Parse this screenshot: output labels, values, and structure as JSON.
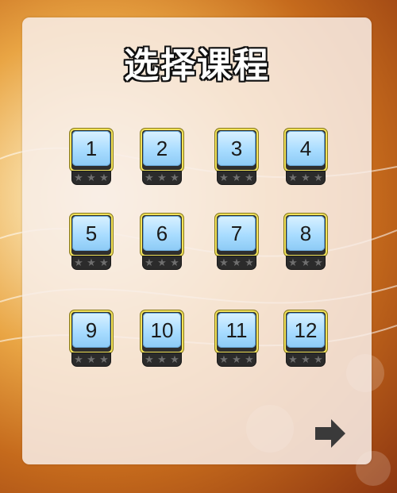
{
  "title": "选择课程",
  "levels": [
    {
      "label": "1",
      "stars": 0
    },
    {
      "label": "2",
      "stars": 0
    },
    {
      "label": "3",
      "stars": 0
    },
    {
      "label": "4",
      "stars": 0
    },
    {
      "label": "5",
      "stars": 0
    },
    {
      "label": "6",
      "stars": 0
    },
    {
      "label": "7",
      "stars": 0
    },
    {
      "label": "8",
      "stars": 0
    },
    {
      "label": "9",
      "stars": 0
    },
    {
      "label": "10",
      "stars": 0
    },
    {
      "label": "11",
      "stars": 0
    },
    {
      "label": "12",
      "stars": 0
    }
  ],
  "icons": {
    "next": "right-arrow-icon",
    "star": "star-icon"
  },
  "colors": {
    "tile_border": "#f2e35a",
    "tile_face": "#a8dcff",
    "star_empty": "#6e6e6e"
  }
}
